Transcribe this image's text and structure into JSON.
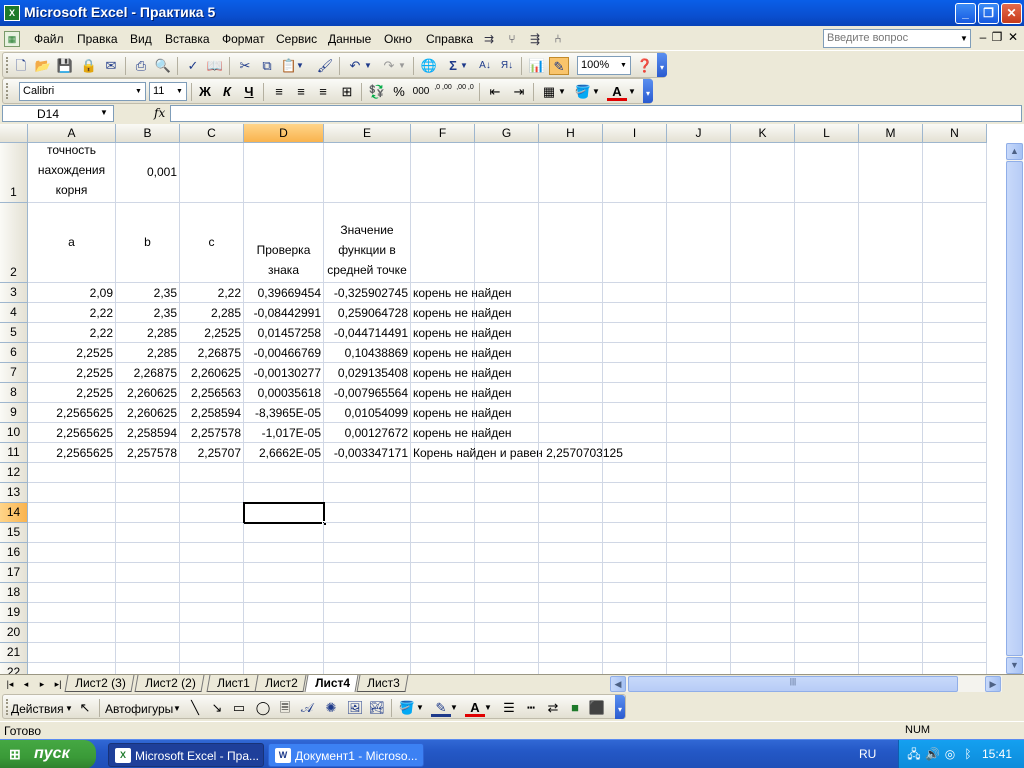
{
  "window": {
    "title": "Microsoft Excel - Практика 5",
    "app_icon": "X",
    "minimize": "_",
    "restore": "❐",
    "close": "✕"
  },
  "menu": {
    "items": [
      "Файл",
      "Правка",
      "Вид",
      "Вставка",
      "Формат",
      "Сервис",
      "Данные",
      "Окно",
      "Справка"
    ],
    "help_placeholder": "Введите вопрос",
    "mdi_min": "–",
    "mdi_restore": "❐",
    "mdi_close": "✕"
  },
  "toolbar": {
    "zoom": "100%",
    "font": "Calibri",
    "font_size": "11",
    "bold": "Ж",
    "italic": "К",
    "underline": "Ч",
    "percent": "%",
    "thousands": "000",
    "inc_dec": ",0 ,00",
    "dec_dec": ",00 ,0"
  },
  "formula_bar": {
    "name_box": "D14",
    "fx": "fx",
    "content": ""
  },
  "columns": [
    "A",
    "B",
    "C",
    "D",
    "E",
    "F",
    "G",
    "H",
    "I",
    "J",
    "K",
    "L",
    "M",
    "N"
  ],
  "selected_column": "D",
  "selected_row": "14",
  "rows": [
    {
      "n": "1",
      "cells": {
        "A": "точность нахождения корня",
        "B": "0,001"
      }
    },
    {
      "n": "2",
      "cells": {
        "A": "a",
        "B": "b",
        "C": "c",
        "D": "Проверка знака",
        "E": "Значение функции в средней точке"
      }
    },
    {
      "n": "3",
      "cells": {
        "A": "2,09",
        "B": "2,35",
        "C": "2,22",
        "D": "0,39669454",
        "E": "-0,325902745",
        "F": "корень не найден"
      }
    },
    {
      "n": "4",
      "cells": {
        "A": "2,22",
        "B": "2,35",
        "C": "2,285",
        "D": "-0,08442991",
        "E": "0,259064728",
        "F": "корень не найден"
      }
    },
    {
      "n": "5",
      "cells": {
        "A": "2,22",
        "B": "2,285",
        "C": "2,2525",
        "D": "0,01457258",
        "E": "-0,044714491",
        "F": "корень не найден"
      }
    },
    {
      "n": "6",
      "cells": {
        "A": "2,2525",
        "B": "2,285",
        "C": "2,26875",
        "D": "-0,00466769",
        "E": "0,10438869",
        "F": "корень не найден"
      }
    },
    {
      "n": "7",
      "cells": {
        "A": "2,2525",
        "B": "2,26875",
        "C": "2,260625",
        "D": "-0,00130277",
        "E": "0,029135408",
        "F": "корень не найден"
      }
    },
    {
      "n": "8",
      "cells": {
        "A": "2,2525",
        "B": "2,260625",
        "C": "2,256563",
        "D": "0,00035618",
        "E": "-0,007965564",
        "F": "корень не найден"
      }
    },
    {
      "n": "9",
      "cells": {
        "A": "2,2565625",
        "B": "2,260625",
        "C": "2,258594",
        "D": "-8,3965E-05",
        "E": "0,01054099",
        "F": "корень не найден"
      }
    },
    {
      "n": "10",
      "cells": {
        "A": "2,2565625",
        "B": "2,258594",
        "C": "2,257578",
        "D": "-1,017E-05",
        "E": "0,00127672",
        "F": "корень не найден"
      }
    },
    {
      "n": "11",
      "cells": {
        "A": "2,2565625",
        "B": "2,257578",
        "C": "2,25707",
        "D": "2,6662E-05",
        "E": "-0,003347171",
        "F": "Корень найден и равен 2,2570703125"
      }
    },
    {
      "n": "12",
      "cells": {}
    },
    {
      "n": "13",
      "cells": {}
    },
    {
      "n": "14",
      "cells": {}
    },
    {
      "n": "15",
      "cells": {}
    },
    {
      "n": "16",
      "cells": {}
    },
    {
      "n": "17",
      "cells": {}
    },
    {
      "n": "18",
      "cells": {}
    },
    {
      "n": "19",
      "cells": {}
    },
    {
      "n": "20",
      "cells": {}
    },
    {
      "n": "21",
      "cells": {}
    },
    {
      "n": "22",
      "cells": {}
    }
  ],
  "sheets": {
    "tabs": [
      "Лист2 (3)",
      "Лист2 (2)",
      "Лист1",
      "Лист2",
      "Лист4",
      "Лист3"
    ],
    "active": "Лист4"
  },
  "drawing": {
    "actions": "Действия",
    "autoshapes": "Автофигуры"
  },
  "status": {
    "ready": "Готово",
    "num": "NUM"
  },
  "taskbar": {
    "start": "пуск",
    "items": [
      {
        "label": "Microsoft Excel - Пра...",
        "active": true
      },
      {
        "label": "Документ1 - Microso...",
        "active": false
      }
    ],
    "lang": "RU",
    "clock": "15:41"
  }
}
